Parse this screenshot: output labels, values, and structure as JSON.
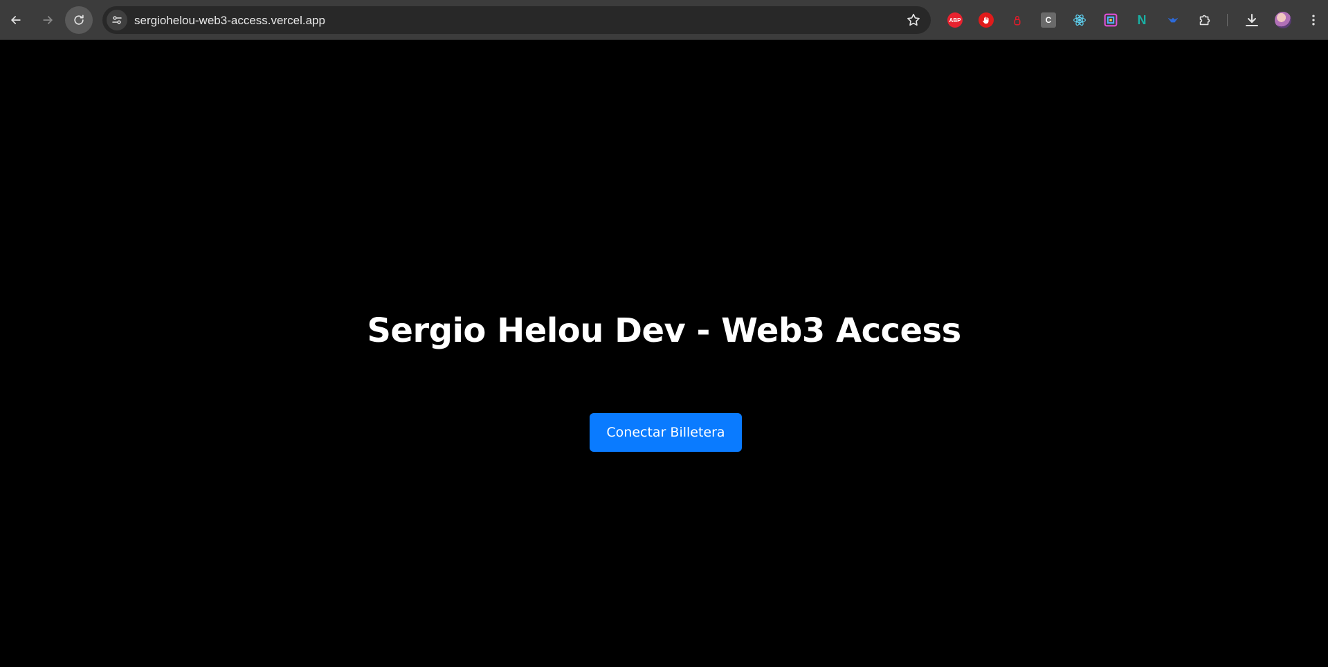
{
  "browser": {
    "url": "sergiohelou-web3-access.vercel.app",
    "extensions": [
      {
        "name": "adblock-plus-icon",
        "label": "ABP"
      },
      {
        "name": "stop-hand-extension-icon",
        "label": ""
      },
      {
        "name": "lock-extension-icon",
        "label": ""
      },
      {
        "name": "c-extension-icon",
        "label": "C"
      },
      {
        "name": "react-devtools-icon",
        "label": ""
      },
      {
        "name": "color-grid-extension-icon",
        "label": ""
      },
      {
        "name": "n-extension-icon",
        "label": "N"
      },
      {
        "name": "bird-extension-icon",
        "label": ""
      },
      {
        "name": "extensions-puzzle-icon",
        "label": ""
      }
    ]
  },
  "page": {
    "title": "Sergio Helou Dev - Web3 Access",
    "connect_button": "Conectar Billetera"
  },
  "colors": {
    "background": "#000000",
    "accent": "#0a7bff",
    "browser_chrome": "#3c3c3c"
  }
}
